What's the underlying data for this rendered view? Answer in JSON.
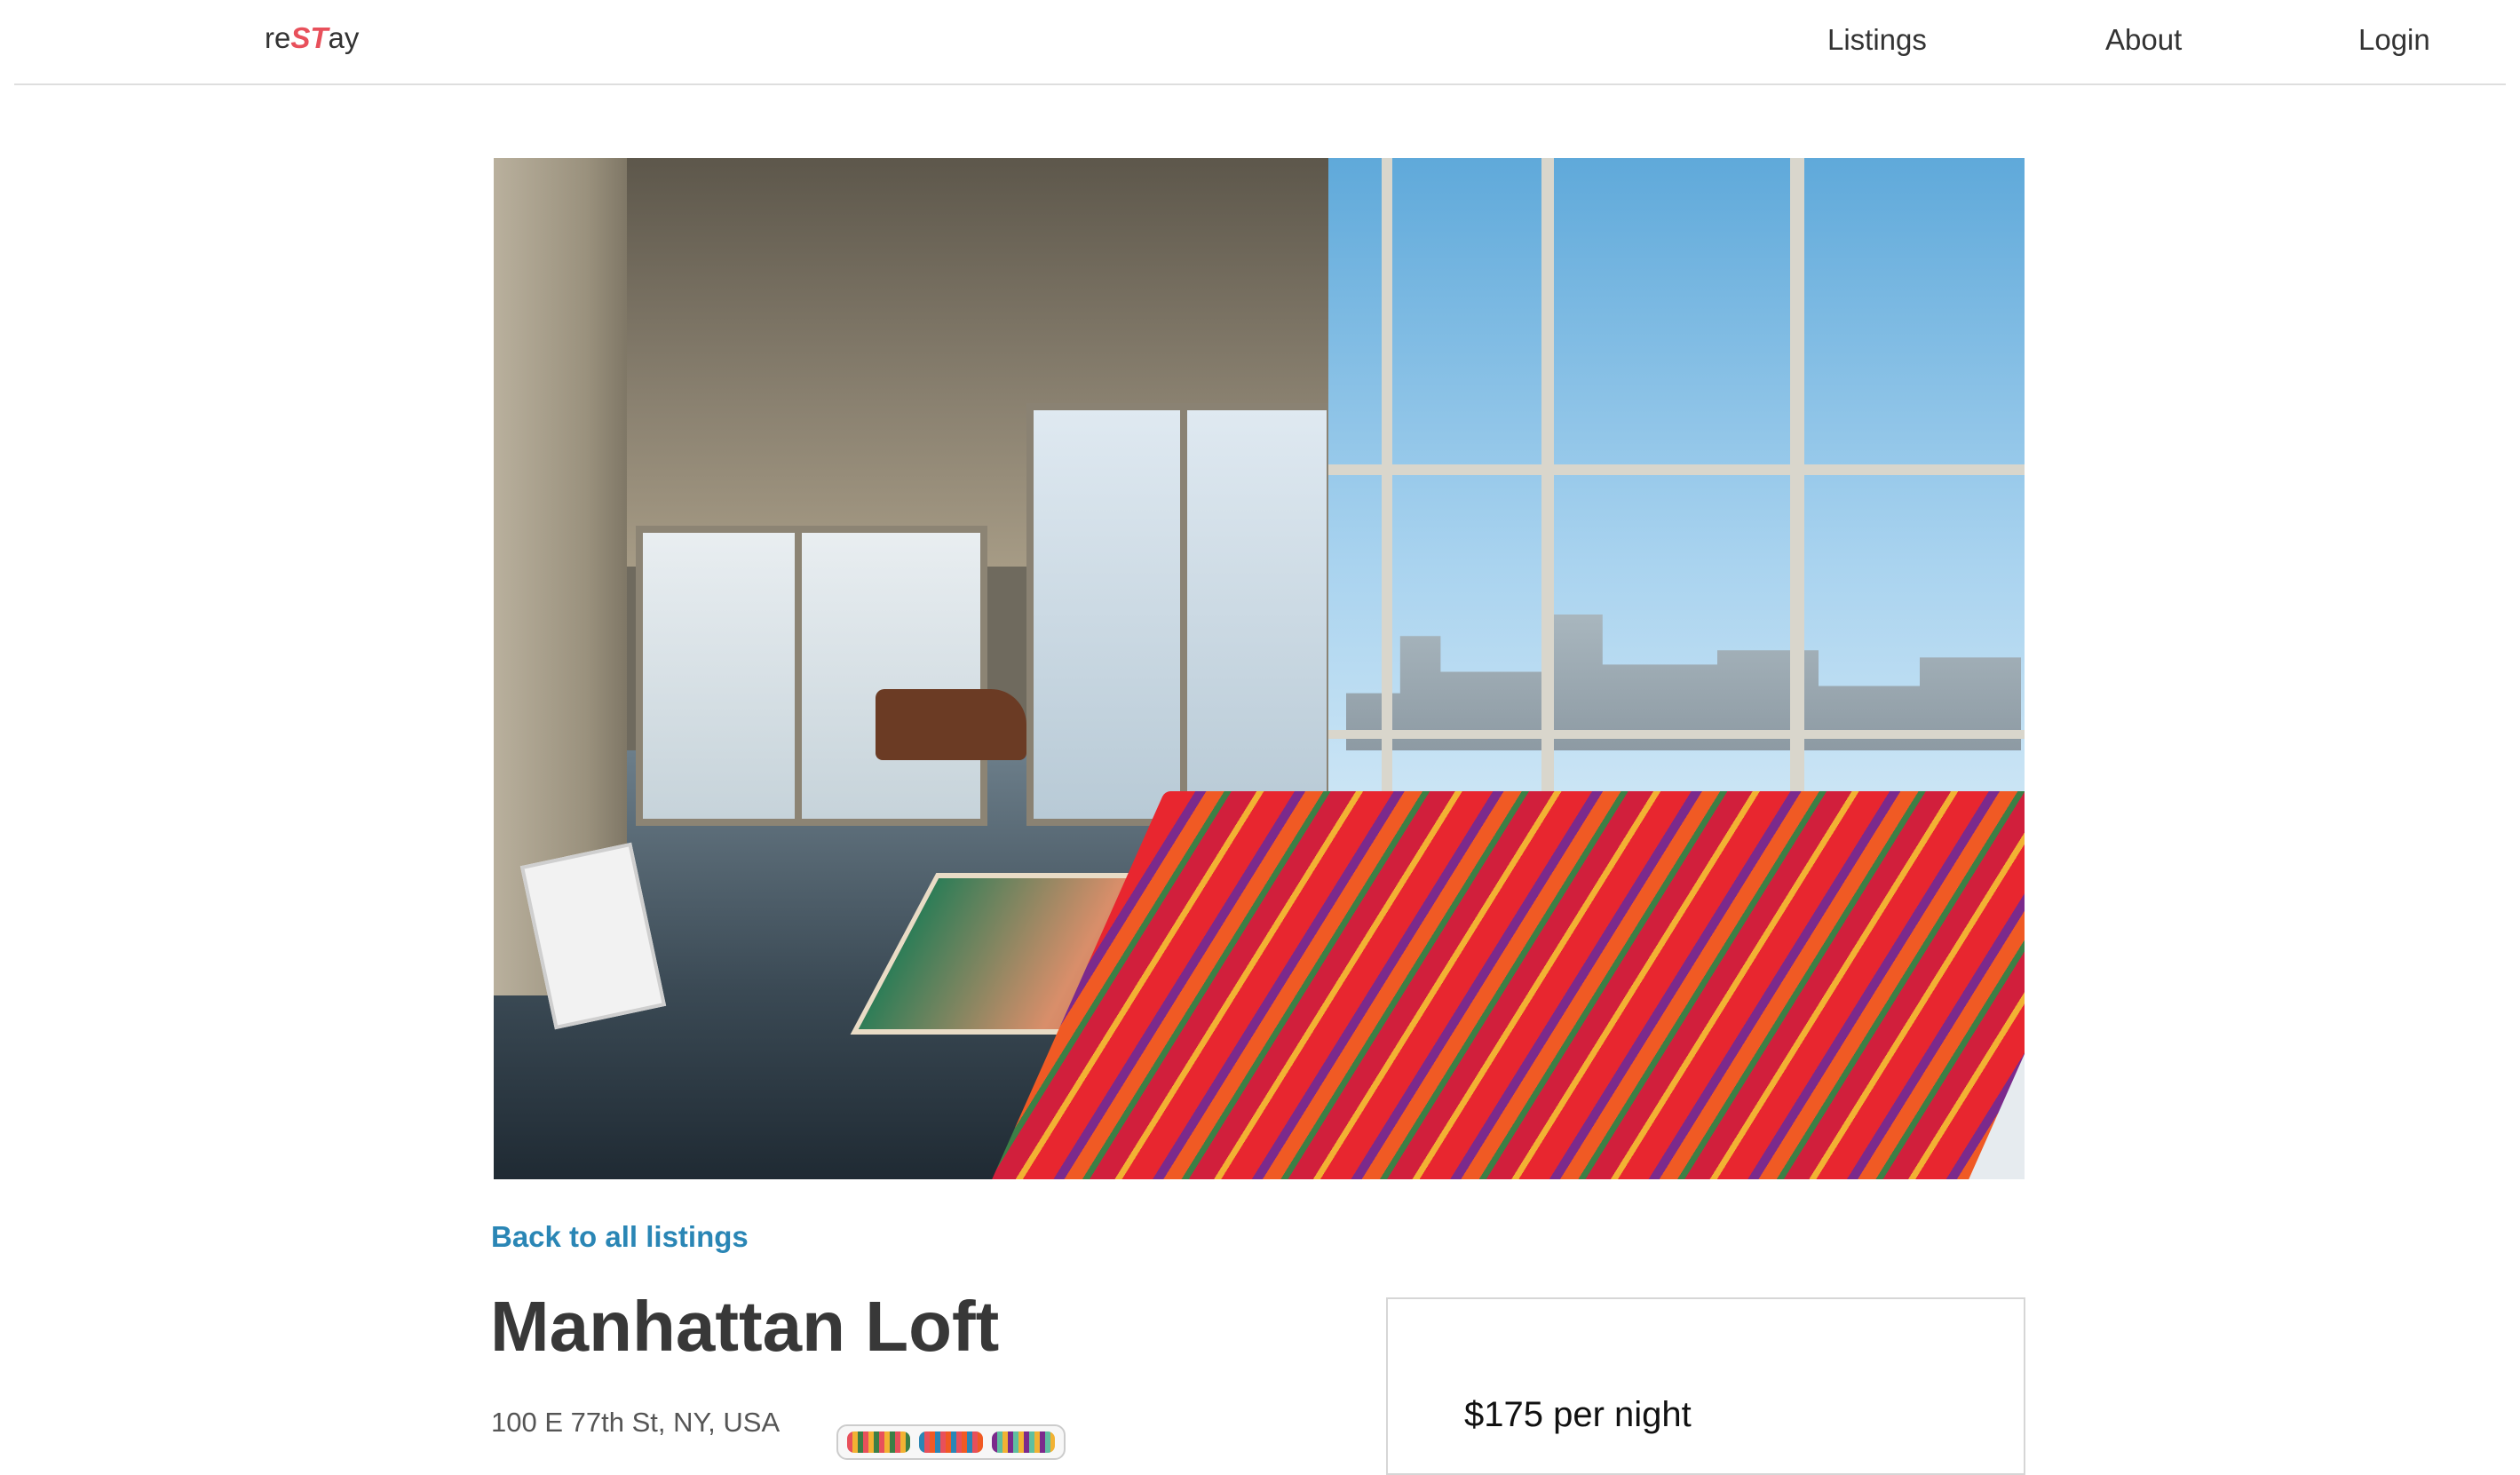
{
  "header": {
    "brand": {
      "prefix": "re",
      "highlight": "ST",
      "suffix": "ay"
    },
    "nav": [
      {
        "label": "Listings"
      },
      {
        "label": "About"
      },
      {
        "label": "Login"
      }
    ]
  },
  "listing": {
    "back_link": "Back to all listings",
    "title": "Manhattan Loft",
    "address": "100 E 77th St, NY, USA",
    "price": "$175 per night"
  },
  "colors": {
    "brand_accent": "#e8505b",
    "link": "#2a86b5",
    "text": "#333333"
  }
}
